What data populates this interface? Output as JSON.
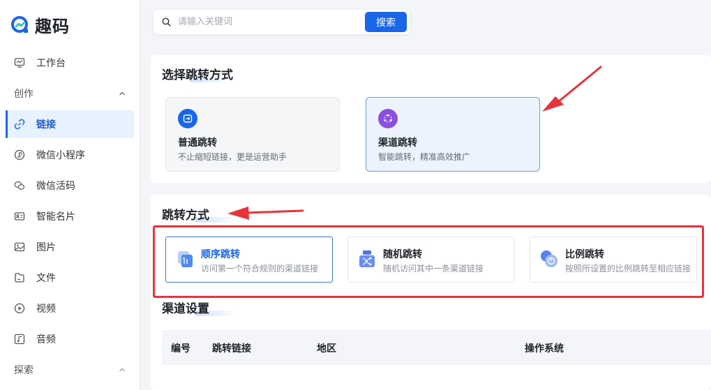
{
  "app": {
    "name": "趣码"
  },
  "sidebar": {
    "items": [
      {
        "label": "工作台",
        "icon": "monitor-icon"
      },
      {
        "label": "链接",
        "icon": "link-icon",
        "active": true
      },
      {
        "label": "微信小程序",
        "icon": "miniprogram-icon"
      },
      {
        "label": "微信活码",
        "icon": "wechat-icon"
      },
      {
        "label": "智能名片",
        "icon": "card-icon"
      },
      {
        "label": "图片",
        "icon": "image-icon"
      },
      {
        "label": "文件",
        "icon": "file-icon"
      },
      {
        "label": "视频",
        "icon": "video-icon"
      },
      {
        "label": "音频",
        "icon": "audio-icon"
      }
    ],
    "groups": [
      {
        "label": "创作",
        "icon": "chevron-up-icon"
      },
      {
        "label": "探索",
        "icon": "chevron-up-icon"
      }
    ]
  },
  "search": {
    "placeholder": "请输入关键词",
    "button": "搜索"
  },
  "jump_type": {
    "title": "选择跳转方式",
    "options": [
      {
        "title": "普通跳转",
        "desc": "不止缩短链接，更是运营助手",
        "icon": "redirect-icon",
        "color": "#1a66e8"
      },
      {
        "title": "渠道跳转",
        "desc": "智能跳转，精准高效推广",
        "icon": "channel-icon",
        "color": "#8b4fe0",
        "selected": true
      }
    ]
  },
  "jump_mode": {
    "title": "跳转方式",
    "modes": [
      {
        "title": "顺序跳转",
        "desc": "访问第一个符合规则的渠道链接",
        "icon": "sequence-icon",
        "selected": true
      },
      {
        "title": "随机跳转",
        "desc": "随机访问其中一条渠道链接",
        "icon": "shuffle-icon"
      },
      {
        "title": "比例跳转",
        "desc": "按照所设置的比例跳转至相应链接",
        "icon": "ratio-icon"
      }
    ]
  },
  "channel": {
    "title": "渠道设置",
    "columns": [
      "编号",
      "跳转链接",
      "地区",
      "操作系统"
    ]
  },
  "colors": {
    "accent": "#1a66e8",
    "annotation": "#e8333a"
  }
}
